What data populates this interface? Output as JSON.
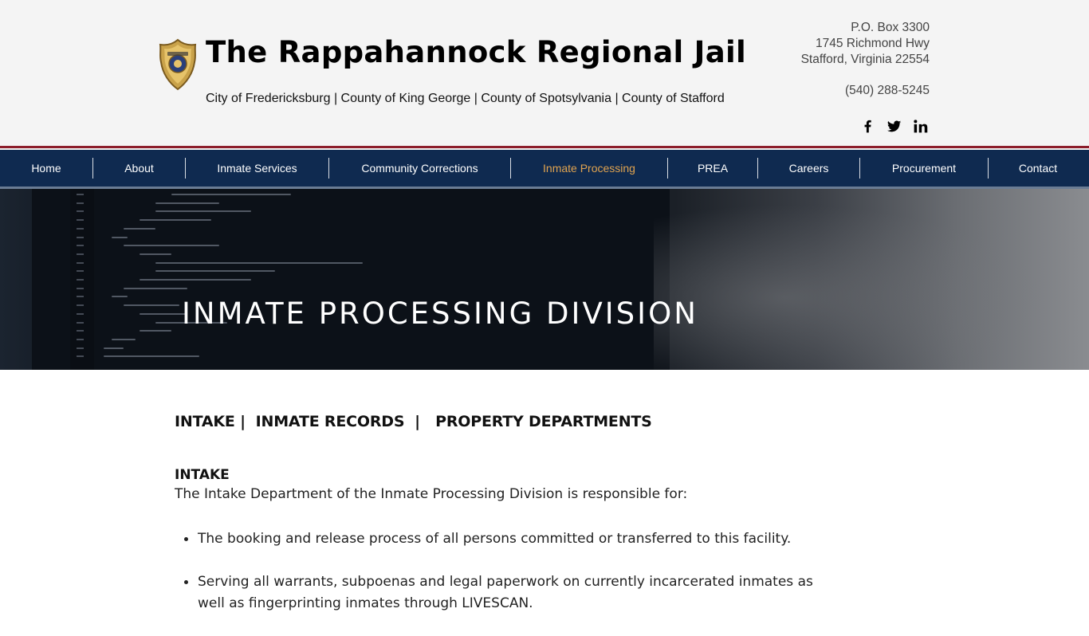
{
  "header": {
    "title": "The Rappahannock Regional Jail",
    "localities": "City of Fredericksburg  | County of King George  |  County of Spotsylvania  |  County of Stafford",
    "address": {
      "line1": "P.O. Box 3300",
      "line2": "1745 Richmond Hwy",
      "line3": "Stafford, Virginia 22554",
      "phone": "(540) 288-5245"
    },
    "social": [
      "facebook-icon",
      "twitter-icon",
      "linkedin-icon"
    ]
  },
  "nav": {
    "items": [
      {
        "label": "Home"
      },
      {
        "label": "About"
      },
      {
        "label": "Inmate Services"
      },
      {
        "label": "Community Corrections"
      },
      {
        "label": "Inmate Processing"
      },
      {
        "label": "PREA"
      },
      {
        "label": "Careers"
      },
      {
        "label": "Procurement"
      },
      {
        "label": "Contact"
      }
    ],
    "active_index": 4,
    "active_color": "#e0a34f",
    "bar_color": "#0f2a50"
  },
  "hero": {
    "title": "INMATE PROCESSING DIVISION"
  },
  "content": {
    "dept_links": "INTAKE |  INMATE RECORDS  |   PROPERTY DEPARTMENTS",
    "intake_heading": "INTAKE",
    "intake_intro": "The Intake Department of the Inmate Processing Division is responsible for:",
    "bullets": [
      "The booking and release process of all persons committed or transferred to this facility.",
      "Serving all warrants, subpoenas and legal paperwork on currently incarcerated inmates as well as fingerprinting inmates through LIVESCAN."
    ]
  },
  "colors": {
    "header_rule": "#8c1d2a",
    "header_bg": "#f4f4f4"
  }
}
